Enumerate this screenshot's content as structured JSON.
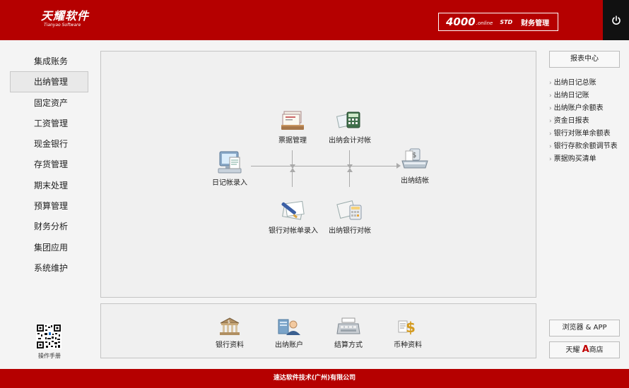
{
  "header": {
    "logo_main": "天耀软件",
    "logo_sub": "Tianyao Software",
    "edition_num": "4000",
    "edition_online": ".online",
    "edition_std": "STD",
    "edition_title": "财务管理"
  },
  "left_nav": {
    "items": [
      {
        "label": "集成账务"
      },
      {
        "label": "出纳管理"
      },
      {
        "label": "固定资产"
      },
      {
        "label": "工资管理"
      },
      {
        "label": "现金银行"
      },
      {
        "label": "存货管理"
      },
      {
        "label": "期末处理"
      },
      {
        "label": "预算管理"
      },
      {
        "label": "财务分析"
      },
      {
        "label": "集团应用"
      },
      {
        "label": "系统维护"
      }
    ],
    "active_index": 1,
    "qr_label": "操作手册"
  },
  "flow": {
    "journal_entry": "日记帐录入",
    "bill_mgmt": "票据管理",
    "cashier_account_check": "出纳会计对帐",
    "cashier_close": "出纳结帐",
    "bank_statement_entry": "银行对帐单录入",
    "cashier_bank_check": "出纳银行对帐"
  },
  "bottom": {
    "bank_info": "银行资料",
    "cashier_account": "出纳账户",
    "settlement_method": "结算方式",
    "currency_info": "币种资料"
  },
  "right": {
    "report_center": "报表中心",
    "reports": [
      {
        "label": "出纳日记总账"
      },
      {
        "label": "出纳日记账"
      },
      {
        "label": "出纳账户余额表"
      },
      {
        "label": "资金日报表"
      },
      {
        "label": "银行对账单余额表"
      },
      {
        "label": "银行存款余额调节表"
      },
      {
        "label": "票据购买清单"
      }
    ],
    "browser_app": "浏览器 & APP",
    "store_prefix": "天耀",
    "store_letter": "A",
    "store_suffix": "商店"
  },
  "footer": {
    "text": "速达软件技术(广州)有限公司"
  },
  "colors": {
    "brand_red": "#b50000",
    "power_bg": "#111111"
  }
}
